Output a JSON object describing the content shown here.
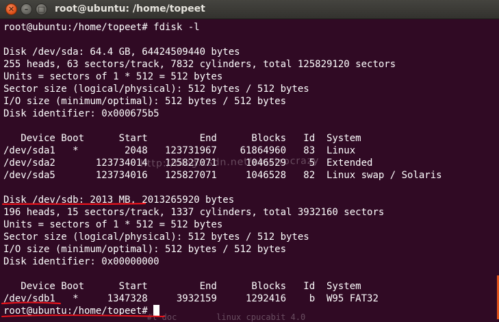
{
  "window": {
    "title": "root@ubuntu: /home/topeet",
    "close_glyph": "✕",
    "minimize_glyph": "–",
    "maximize_glyph": "□"
  },
  "terminal": {
    "lines": [
      "root@ubuntu:/home/topeet# fdisk -l",
      "",
      "Disk /dev/sda: 64.4 GB, 64424509440 bytes",
      "255 heads, 63 sectors/track, 7832 cylinders, total 125829120 sectors",
      "Units = sectors of 1 * 512 = 512 bytes",
      "Sector size (logical/physical): 512 bytes / 512 bytes",
      "I/O size (minimum/optimal): 512 bytes / 512 bytes",
      "Disk identifier: 0x000675b5",
      "",
      "   Device Boot      Start         End      Blocks   Id  System",
      "/dev/sda1   *        2048   123731967    61864960   83  Linux",
      "/dev/sda2       123734014   125827071     1046529    5  Extended",
      "/dev/sda5       123734016   125827071     1046528   82  Linux swap / Solaris",
      "",
      "Disk /dev/sdb: 2013 MB, 2013265920 bytes",
      "196 heads, 15 sectors/track, 1337 cylinders, total 3932160 sectors",
      "Units = sectors of 1 * 512 = 512 bytes",
      "Sector size (logical/physical): 512 bytes / 512 bytes",
      "I/O size (minimum/optimal): 512 bytes / 512 bytes",
      "Disk identifier: 0x00000000",
      "",
      "   Device Boot      Start         End      Blocks   Id  System",
      "/dev/sdb1   *     1347328     3932159     1292416    b  W95 FAT32"
    ],
    "prompt": "root@ubuntu:/home/topeet# "
  },
  "watermark": "http://blog.csdn.net/electrocrazy",
  "bottom_ghost_text": "#l doc        linux cpucabit 4.0",
  "colors": {
    "background": "#300a24",
    "text": "#ffffff",
    "annotation": "#e8141c",
    "accent": "#e0531c"
  }
}
